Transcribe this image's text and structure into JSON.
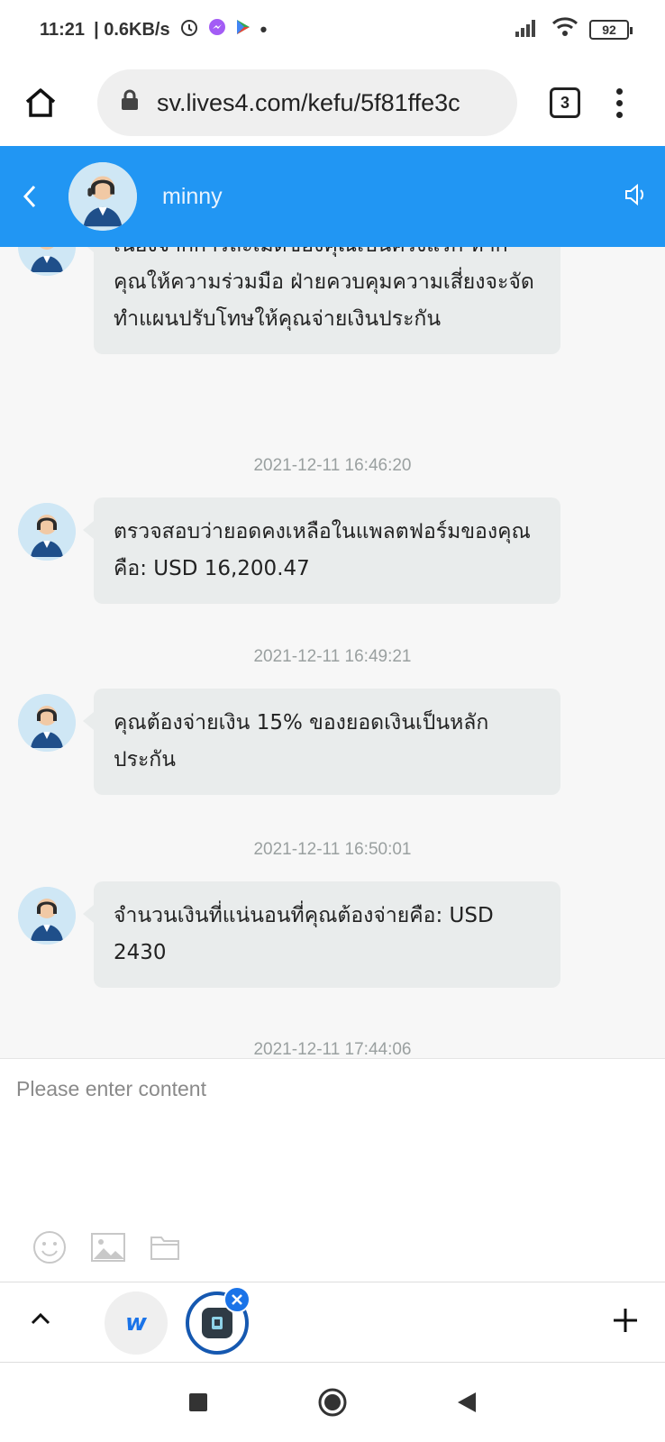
{
  "status_bar": {
    "time": "11:21",
    "network_speed": "| 0.6KB/s",
    "battery": "92"
  },
  "browser": {
    "url": "sv.lives4.com/kefu/5f81ffe3c",
    "tab_count": "3"
  },
  "chat_header": {
    "agent_name": "minny"
  },
  "messages": [
    {
      "text": "เนื่องจากการละเมิดของคุณเป็นครั้งแรก หากคุณให้ความร่วมมือ ฝ่ายควบคุมความเสี่ยงจะจัดทำแผนปรับโทษให้คุณจ่ายเงินประกัน"
    },
    {
      "timestamp": "2021-12-11 16:46:20",
      "text": "ตรวจสอบว่ายอดคงเหลือในแพลตฟอร์มของคุณคือ: USD 16,200.47"
    },
    {
      "timestamp": "2021-12-11 16:49:21",
      "text": "คุณต้องจ่ายเงิน 15% ของยอดเงินเป็นหลักประกัน"
    },
    {
      "timestamp": "2021-12-11 16:50:01",
      "text": "จำนวนเงินที่แน่นอนที่คุณต้องจ่ายคือ: USD 2430"
    },
    {
      "timestamp": "2021-12-11 17:44:06"
    }
  ],
  "input": {
    "placeholder": "Please enter content"
  },
  "bottom_bar": {
    "app_w_label": "w"
  }
}
